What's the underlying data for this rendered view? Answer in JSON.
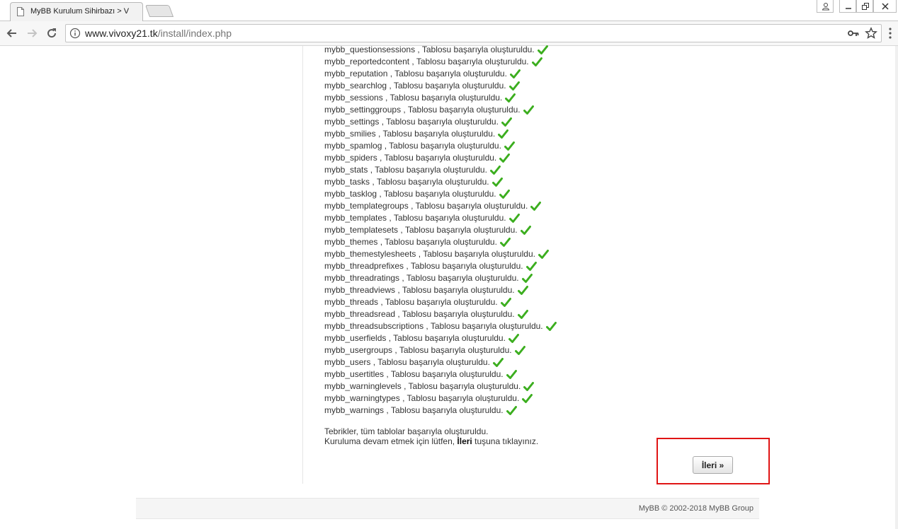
{
  "browser": {
    "tab_title": "MyBB Kurulum Sihirbazı > V",
    "url_host": "www.vivoxy21.tk",
    "url_path": "/install/index.php"
  },
  "tables": [
    "mybb_questionsessions",
    "mybb_reportedcontent",
    "mybb_reputation",
    "mybb_searchlog",
    "mybb_sessions",
    "mybb_settinggroups",
    "mybb_settings",
    "mybb_smilies",
    "mybb_spamlog",
    "mybb_spiders",
    "mybb_stats",
    "mybb_tasks",
    "mybb_tasklog",
    "mybb_templategroups",
    "mybb_templates",
    "mybb_templatesets",
    "mybb_themes",
    "mybb_themestylesheets",
    "mybb_threadprefixes",
    "mybb_threadratings",
    "mybb_threadviews",
    "mybb_threads",
    "mybb_threadsread",
    "mybb_threadsubscriptions",
    "mybb_userfields",
    "mybb_usergroups",
    "mybb_users",
    "mybb_usertitles",
    "mybb_warninglevels",
    "mybb_warningtypes",
    "mybb_warnings"
  ],
  "row_suffix": " , Tablosu başarıyla oluşturuldu.",
  "message": {
    "line1": "Tebrikler, tüm tablolar başarıyla oluşturuldu.",
    "line2_before": "Kuruluma devam etmek için lütfen, ",
    "line2_bold": "İleri",
    "line2_after": " tuşuna tıklayınız."
  },
  "next_button_label": "İleri »",
  "footer_text": "MyBB © 2002-2018 MyBB Group",
  "colors": {
    "check": "#3cae1f",
    "highlight": "#e01515"
  },
  "icons": {
    "row_status": "check-icon"
  }
}
